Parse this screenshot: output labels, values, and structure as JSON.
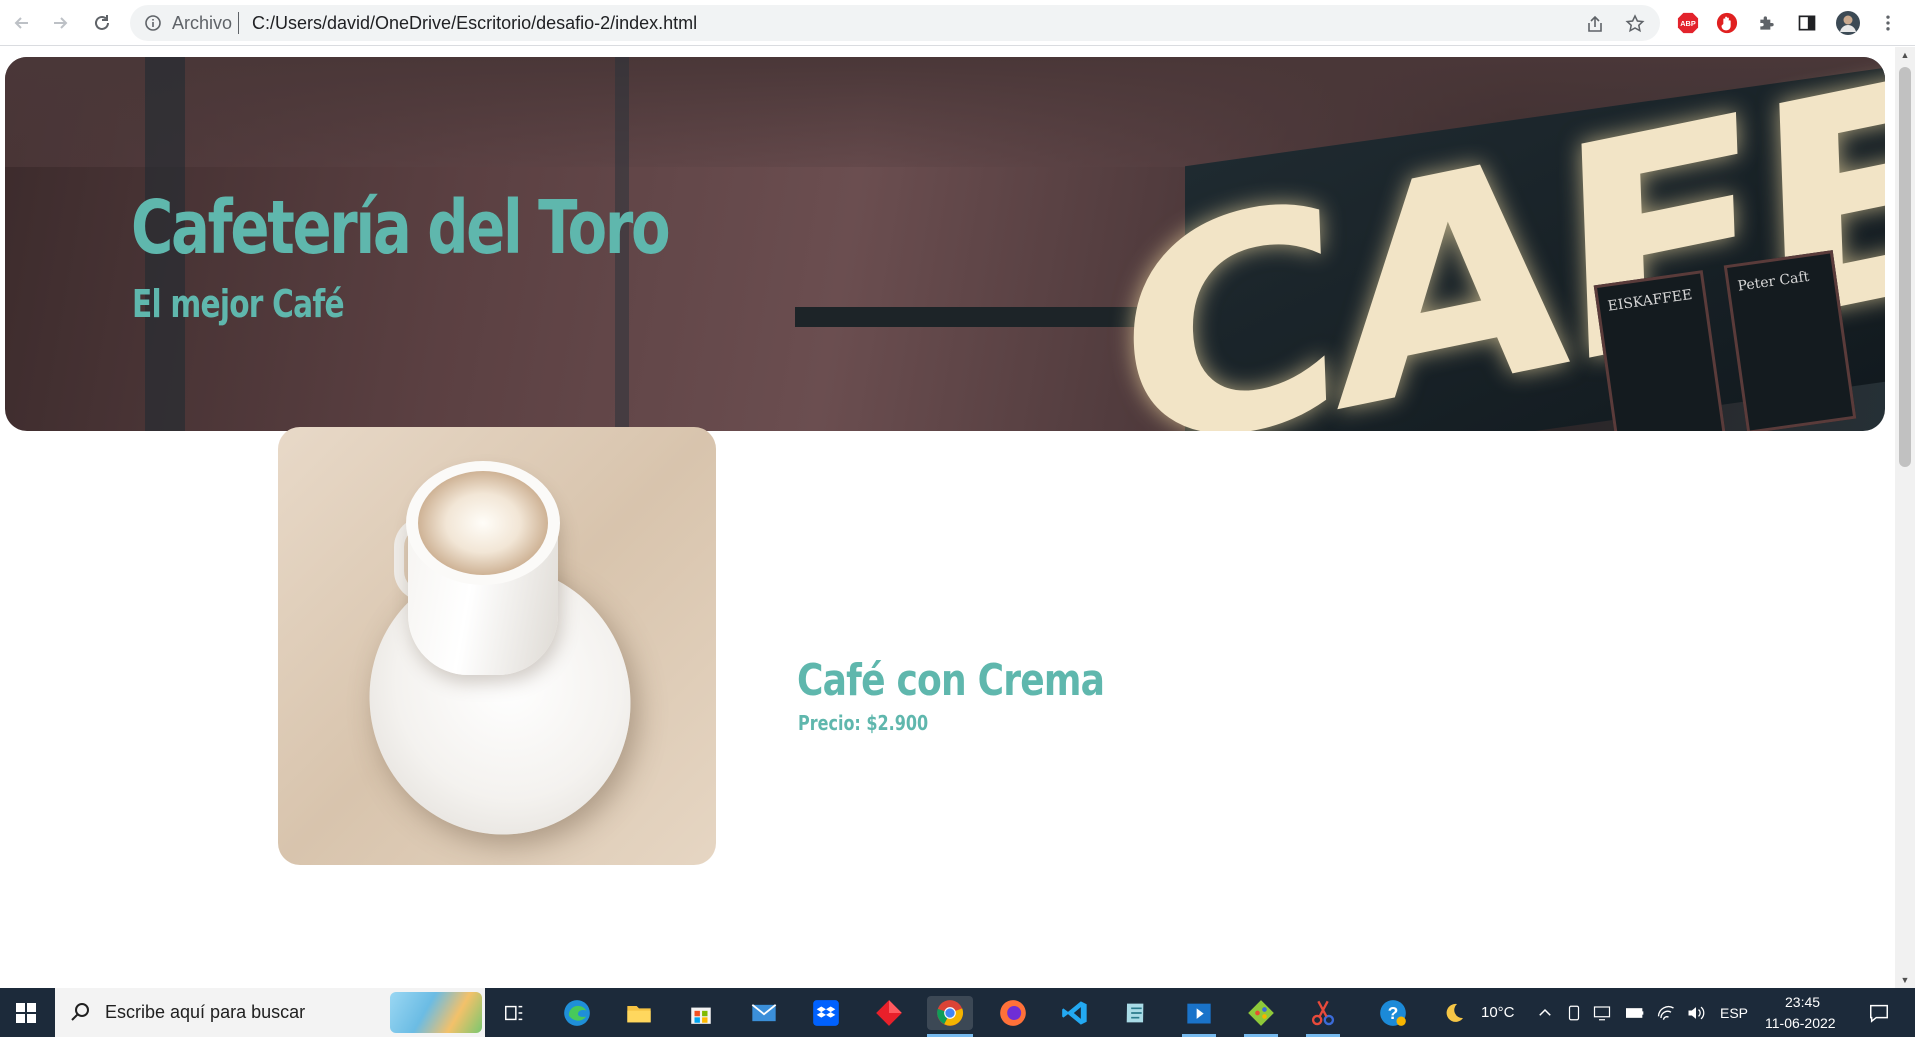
{
  "browser": {
    "scheme_label": "Archivo",
    "url": "C:/Users/david/OneDrive/Escritorio/desafio-2/index.html",
    "nav": [
      "back-icon",
      "forward-icon",
      "reload-icon"
    ],
    "actions": [
      "share-icon",
      "bookmark-star-icon"
    ],
    "extensions": [
      "adblock-plus-icon",
      "stop-sign-extension-icon",
      "puzzle-extensions-icon",
      "side-panel-icon",
      "profile-avatar",
      "kebab-menu-icon"
    ]
  },
  "page": {
    "hero": {
      "title": "Cafetería del Toro",
      "subtitle": "El mejor Café",
      "sign_text": "CAFE",
      "board_left": "EISKAFFEE",
      "board_right": "Peter Caft"
    },
    "product": {
      "name": "Café con Crema",
      "price": "Precio: $2.900"
    },
    "accent_color": "#5fb7ad"
  },
  "taskbar": {
    "search_placeholder": "Escribe aquí para buscar",
    "apps": [
      "task-view-icon",
      "edge-icon",
      "file-explorer-icon",
      "microsoft-store-icon",
      "mail-icon",
      "dropbox-icon",
      "red-diamond-app-icon",
      "chrome-icon",
      "firefox-icon",
      "vscode-icon",
      "notepad-app-icon",
      "video-player-icon",
      "git-icon",
      "snipping-tool-icon"
    ],
    "help_icon": "help-icon",
    "weather": {
      "icon": "moon-icon",
      "temperature": "10°C"
    },
    "language": "ESP",
    "time": "23:45",
    "date": "11-06-2022"
  }
}
